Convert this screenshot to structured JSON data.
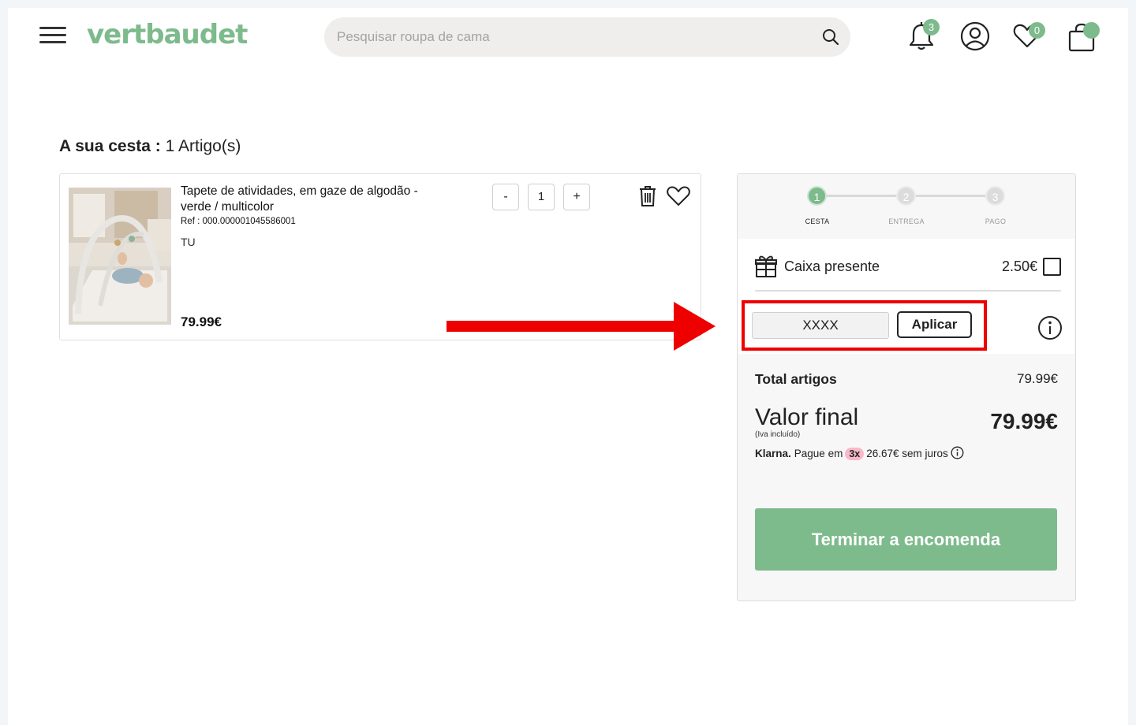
{
  "header": {
    "logo": "vertbaudet",
    "search_placeholder": "Pesquisar roupa de cama",
    "notifications_count": "3",
    "wishlist_count": "0"
  },
  "basket": {
    "title_bold": "A sua cesta :",
    "title_count": "1 Artigo(s)"
  },
  "product": {
    "name": "Tapete de atividades, em gaze de algodão - verde / multicolor",
    "ref": "Ref : 000.000001045586001",
    "size": "TU",
    "price": "79.99€",
    "quantity": "1",
    "minus_label": "-",
    "plus_label": "+"
  },
  "summary": {
    "steps": [
      {
        "num": "1",
        "label": "CESTA",
        "active": true
      },
      {
        "num": "2",
        "label": "ENTREGA",
        "active": false
      },
      {
        "num": "3",
        "label": "PAGO",
        "active": false
      }
    ],
    "gift_label": "Caixa presente",
    "gift_price": "2.50€",
    "promo_value": "XXXX",
    "apply_label": "Aplicar",
    "total_label": "Total artigos",
    "total_value": "79.99€",
    "final_label": "Valor final",
    "final_sub": "(Iva incluído)",
    "final_value": "79.99€",
    "klarna_brand": "Klarna.",
    "klarna_text1": "Pague em",
    "klarna_pill": "3x",
    "klarna_text2": "26.67€ sem juros",
    "cta_label": "Terminar a encomenda"
  },
  "colors": {
    "brand_green": "#7dba8c",
    "highlight_red": "#ee0000",
    "klarna_pink": "#f7b8c8"
  }
}
